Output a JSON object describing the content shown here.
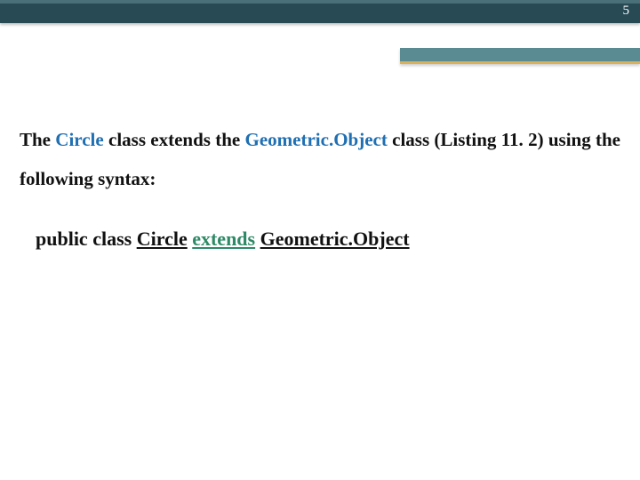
{
  "page_number": "5",
  "para1": {
    "t1": "The ",
    "circle": "Circle",
    "t2": " class extends the ",
    "geo": "Geometric.Object",
    "t3": " class (Listing 11. 2) using the following syntax:"
  },
  "code": {
    "t1": "public class ",
    "circle": "Circle",
    "sp": " ",
    "extends": "extends",
    "geo": "Geometric.Object"
  }
}
